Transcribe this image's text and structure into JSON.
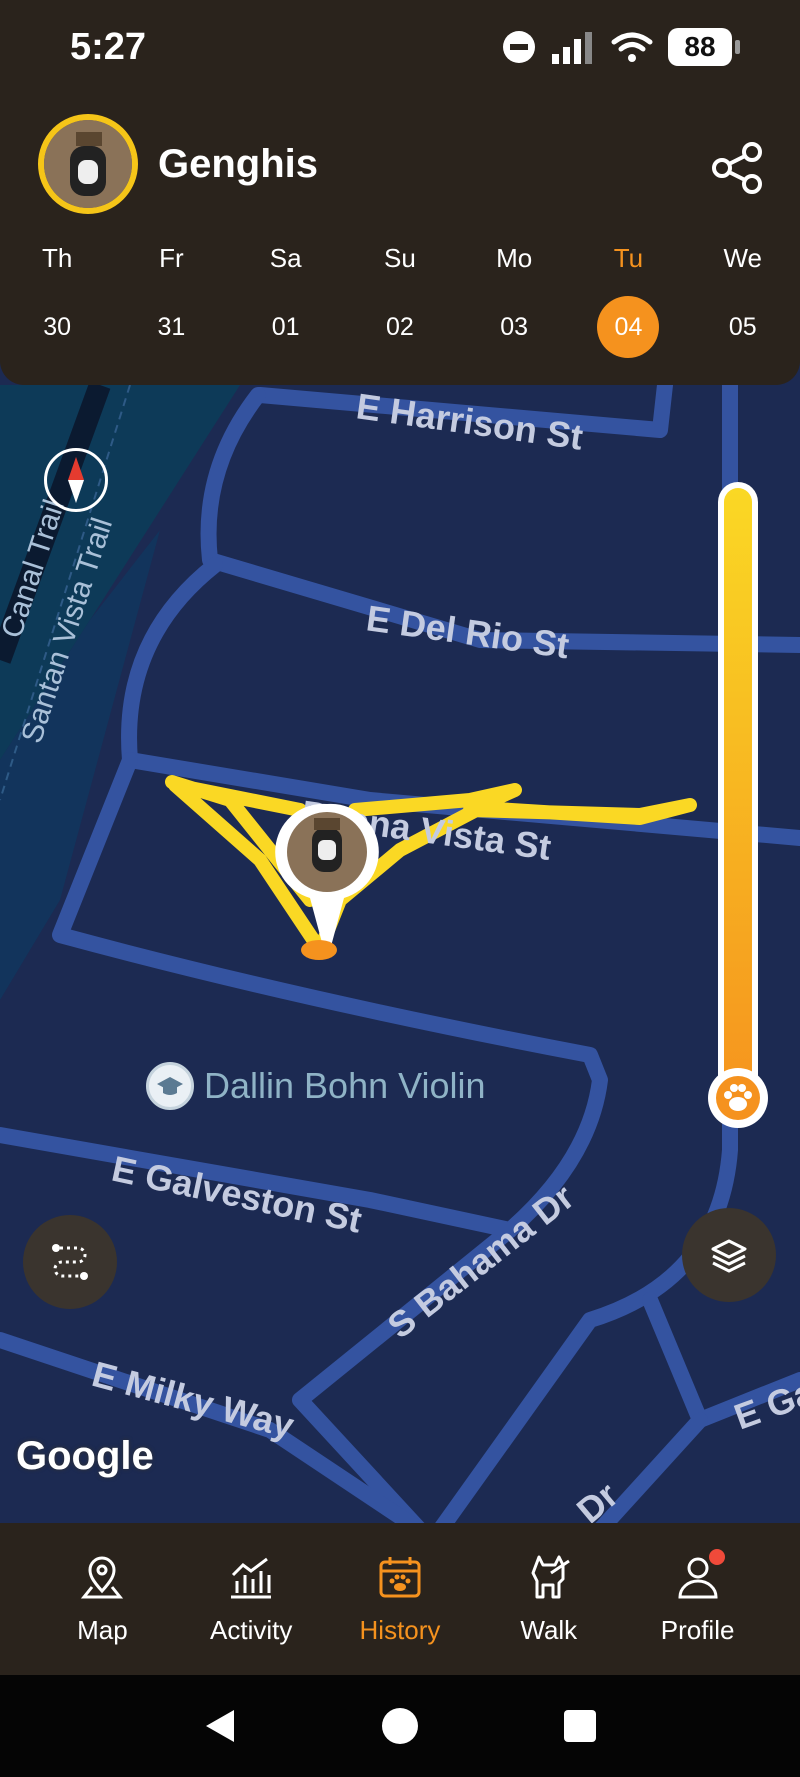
{
  "status_bar": {
    "time": "5:27",
    "battery": "88",
    "icons": [
      "dnd-icon",
      "signal-icon",
      "wifi-icon",
      "battery-icon"
    ]
  },
  "header": {
    "pet_name": "Genghis",
    "share_icon": "share-icon"
  },
  "calendar": {
    "days": [
      {
        "weekday": "Th",
        "date": "30"
      },
      {
        "weekday": "Fr",
        "date": "31"
      },
      {
        "weekday": "Sa",
        "date": "01"
      },
      {
        "weekday": "Su",
        "date": "02"
      },
      {
        "weekday": "Mo",
        "date": "03"
      },
      {
        "weekday": "Tu",
        "date": "04",
        "selected": true
      },
      {
        "weekday": "We",
        "date": "05"
      }
    ]
  },
  "map": {
    "streets": {
      "harrison": "E Harrison St",
      "del_rio": "E Del Rio St",
      "buena_vista": "Buena Vista St",
      "galveston": "E Galveston St",
      "bahama": "S Bahama Dr",
      "milky_way": "E Milky Way",
      "canal_trail": "Canal Trail",
      "santan": "Santan Vista Trail",
      "e_ga": "E Ga",
      "dr": "Dr"
    },
    "poi_label": "Dallin Bohn Violin",
    "attribution": "Google",
    "track_color": "#fad824",
    "slider_color_top": "#fad824",
    "slider_color_bottom": "#f5921e"
  },
  "nav": {
    "items": [
      {
        "label": "Map",
        "icon": "map-pin-icon"
      },
      {
        "label": "Activity",
        "icon": "chart-icon"
      },
      {
        "label": "History",
        "icon": "calendar-paw-icon",
        "active": true
      },
      {
        "label": "Walk",
        "icon": "dog-walk-icon"
      },
      {
        "label": "Profile",
        "icon": "person-icon",
        "badge": true
      }
    ]
  },
  "colors": {
    "accent": "#f5921e",
    "header_bg": "#2a231c",
    "map_bg": "#1c2a52"
  }
}
